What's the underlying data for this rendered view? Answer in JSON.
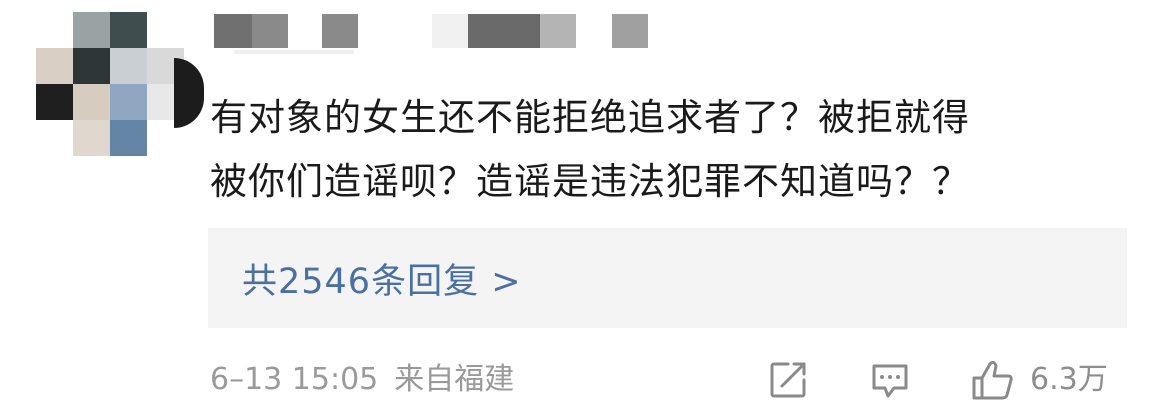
{
  "comment": {
    "text_line1": "有对象的女生还不能拒绝追求者了？被拒就得",
    "text_line2": "被你们造谣呗？造谣是违法犯罪不知道吗？？"
  },
  "replies": {
    "label": "共2546条回复 >"
  },
  "meta": {
    "time": "6–13 15:05",
    "location": "来自福建"
  },
  "actions": {
    "share_icon": "share-icon",
    "comment_icon": "comment-icon",
    "like_icon": "thumbs-up-icon",
    "like_count": "6.3万"
  },
  "colors": {
    "link": "#4a6fa0",
    "meta": "#9a9a9a",
    "reply_bg": "#f4f4f4"
  }
}
